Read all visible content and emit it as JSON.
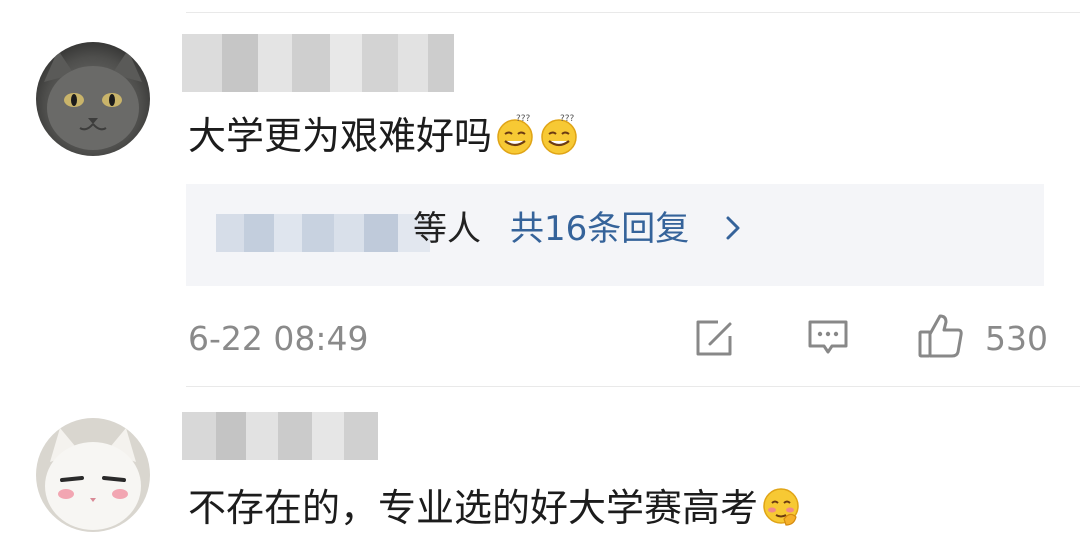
{
  "comments": [
    {
      "text": "大学更为艰难好吗",
      "emoji_names": [
        "dizzy-smile-icon",
        "dizzy-smile-icon"
      ],
      "reply_suffix": "等人",
      "reply_link": "共16条回复",
      "time": "6-22 08:49",
      "likes": "530"
    },
    {
      "text": "不存在的，专业选的好大学赛高考",
      "emoji_names": [
        "blush-hand-icon"
      ]
    }
  ]
}
